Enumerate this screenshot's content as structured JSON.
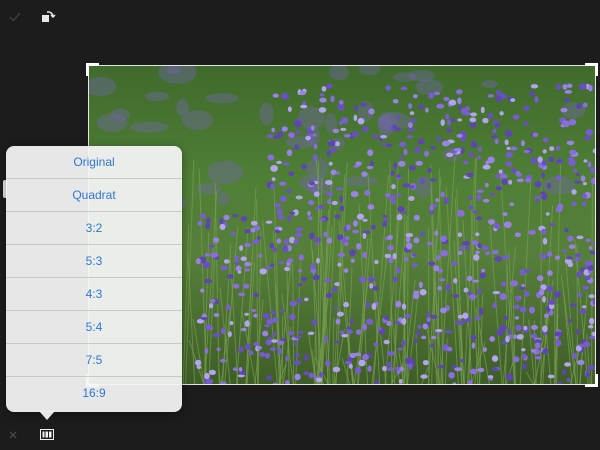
{
  "toolbar": {
    "done_icon": "checkmark-icon",
    "rotate_icon": "rotate-crop-icon",
    "cancel_icon": "close-icon",
    "aspect_icon": "aspect-ratio-icon"
  },
  "aspect_menu": {
    "items": [
      "Original",
      "Quadrat",
      "3:2",
      "5:3",
      "4:3",
      "5:4",
      "7:5",
      "16:9"
    ]
  },
  "colors": {
    "accent": "#2f76d8",
    "background": "#1c1c1c",
    "popover": "#f4f4f4"
  }
}
